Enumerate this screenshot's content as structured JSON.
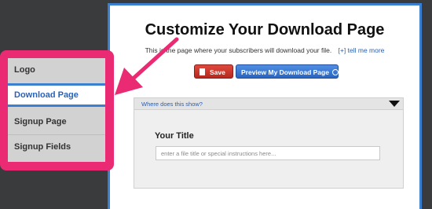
{
  "header": {
    "title": "Customize Your Download Page",
    "subtitle": "This is the page where your subscribers will download your file.",
    "help_link": "[+] tell me more"
  },
  "toolbar": {
    "save_label": "Save",
    "preview_label": "Preview My Download Page"
  },
  "info_bar": {
    "text": "Where does this show?"
  },
  "form": {
    "title_label": "Your Title",
    "title_placeholder": "enter a file title or special instructions here..."
  },
  "sidebar": {
    "items": [
      {
        "label": "Logo",
        "active": false
      },
      {
        "label": "Download Page",
        "active": true
      },
      {
        "label": "Signup Page",
        "active": false
      },
      {
        "label": "Signup Fields",
        "active": false
      }
    ]
  },
  "colors": {
    "highlight": "#ea2a73",
    "accent_blue": "#3a7fd0",
    "save_red": "#c9352a",
    "background": "#3a3b3c"
  },
  "icons": {
    "save": "document-icon",
    "preview": "external-link-icon",
    "collapse": "triangle-down-icon",
    "pointer": "arrow-icon"
  }
}
